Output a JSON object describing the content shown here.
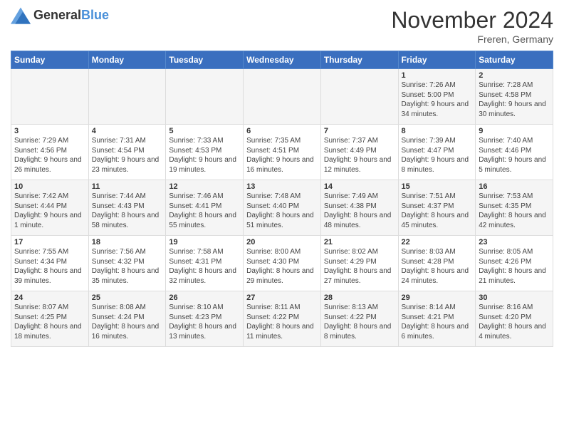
{
  "header": {
    "logo_general": "General",
    "logo_blue": "Blue",
    "month_title": "November 2024",
    "location": "Freren, Germany"
  },
  "weekdays": [
    "Sunday",
    "Monday",
    "Tuesday",
    "Wednesday",
    "Thursday",
    "Friday",
    "Saturday"
  ],
  "weeks": [
    [
      {
        "day": "",
        "info": ""
      },
      {
        "day": "",
        "info": ""
      },
      {
        "day": "",
        "info": ""
      },
      {
        "day": "",
        "info": ""
      },
      {
        "day": "",
        "info": ""
      },
      {
        "day": "1",
        "info": "Sunrise: 7:26 AM\nSunset: 5:00 PM\nDaylight: 9 hours and 34 minutes."
      },
      {
        "day": "2",
        "info": "Sunrise: 7:28 AM\nSunset: 4:58 PM\nDaylight: 9 hours and 30 minutes."
      }
    ],
    [
      {
        "day": "3",
        "info": "Sunrise: 7:29 AM\nSunset: 4:56 PM\nDaylight: 9 hours and 26 minutes."
      },
      {
        "day": "4",
        "info": "Sunrise: 7:31 AM\nSunset: 4:54 PM\nDaylight: 9 hours and 23 minutes."
      },
      {
        "day": "5",
        "info": "Sunrise: 7:33 AM\nSunset: 4:53 PM\nDaylight: 9 hours and 19 minutes."
      },
      {
        "day": "6",
        "info": "Sunrise: 7:35 AM\nSunset: 4:51 PM\nDaylight: 9 hours and 16 minutes."
      },
      {
        "day": "7",
        "info": "Sunrise: 7:37 AM\nSunset: 4:49 PM\nDaylight: 9 hours and 12 minutes."
      },
      {
        "day": "8",
        "info": "Sunrise: 7:39 AM\nSunset: 4:47 PM\nDaylight: 9 hours and 8 minutes."
      },
      {
        "day": "9",
        "info": "Sunrise: 7:40 AM\nSunset: 4:46 PM\nDaylight: 9 hours and 5 minutes."
      }
    ],
    [
      {
        "day": "10",
        "info": "Sunrise: 7:42 AM\nSunset: 4:44 PM\nDaylight: 9 hours and 1 minute."
      },
      {
        "day": "11",
        "info": "Sunrise: 7:44 AM\nSunset: 4:43 PM\nDaylight: 8 hours and 58 minutes."
      },
      {
        "day": "12",
        "info": "Sunrise: 7:46 AM\nSunset: 4:41 PM\nDaylight: 8 hours and 55 minutes."
      },
      {
        "day": "13",
        "info": "Sunrise: 7:48 AM\nSunset: 4:40 PM\nDaylight: 8 hours and 51 minutes."
      },
      {
        "day": "14",
        "info": "Sunrise: 7:49 AM\nSunset: 4:38 PM\nDaylight: 8 hours and 48 minutes."
      },
      {
        "day": "15",
        "info": "Sunrise: 7:51 AM\nSunset: 4:37 PM\nDaylight: 8 hours and 45 minutes."
      },
      {
        "day": "16",
        "info": "Sunrise: 7:53 AM\nSunset: 4:35 PM\nDaylight: 8 hours and 42 minutes."
      }
    ],
    [
      {
        "day": "17",
        "info": "Sunrise: 7:55 AM\nSunset: 4:34 PM\nDaylight: 8 hours and 39 minutes."
      },
      {
        "day": "18",
        "info": "Sunrise: 7:56 AM\nSunset: 4:32 PM\nDaylight: 8 hours and 35 minutes."
      },
      {
        "day": "19",
        "info": "Sunrise: 7:58 AM\nSunset: 4:31 PM\nDaylight: 8 hours and 32 minutes."
      },
      {
        "day": "20",
        "info": "Sunrise: 8:00 AM\nSunset: 4:30 PM\nDaylight: 8 hours and 29 minutes."
      },
      {
        "day": "21",
        "info": "Sunrise: 8:02 AM\nSunset: 4:29 PM\nDaylight: 8 hours and 27 minutes."
      },
      {
        "day": "22",
        "info": "Sunrise: 8:03 AM\nSunset: 4:28 PM\nDaylight: 8 hours and 24 minutes."
      },
      {
        "day": "23",
        "info": "Sunrise: 8:05 AM\nSunset: 4:26 PM\nDaylight: 8 hours and 21 minutes."
      }
    ],
    [
      {
        "day": "24",
        "info": "Sunrise: 8:07 AM\nSunset: 4:25 PM\nDaylight: 8 hours and 18 minutes."
      },
      {
        "day": "25",
        "info": "Sunrise: 8:08 AM\nSunset: 4:24 PM\nDaylight: 8 hours and 16 minutes."
      },
      {
        "day": "26",
        "info": "Sunrise: 8:10 AM\nSunset: 4:23 PM\nDaylight: 8 hours and 13 minutes."
      },
      {
        "day": "27",
        "info": "Sunrise: 8:11 AM\nSunset: 4:22 PM\nDaylight: 8 hours and 11 minutes."
      },
      {
        "day": "28",
        "info": "Sunrise: 8:13 AM\nSunset: 4:22 PM\nDaylight: 8 hours and 8 minutes."
      },
      {
        "day": "29",
        "info": "Sunrise: 8:14 AM\nSunset: 4:21 PM\nDaylight: 8 hours and 6 minutes."
      },
      {
        "day": "30",
        "info": "Sunrise: 8:16 AM\nSunset: 4:20 PM\nDaylight: 8 hours and 4 minutes."
      }
    ]
  ]
}
